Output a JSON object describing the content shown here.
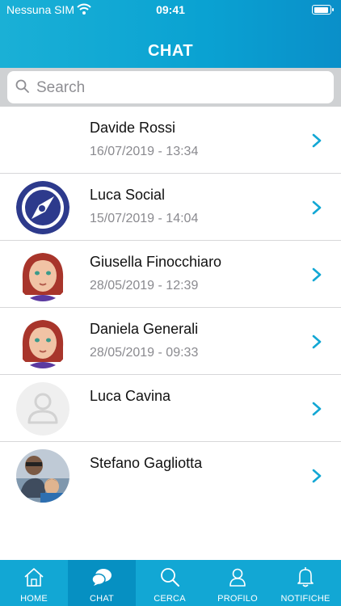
{
  "status_bar": {
    "carrier": "Nessuna SIM",
    "time": "09:41"
  },
  "header": {
    "title": "CHAT"
  },
  "search": {
    "placeholder": "Search"
  },
  "chats": [
    {
      "name": "Davide Rossi",
      "date": "16/07/2019 - 13:34",
      "avatar": "blank-avatar"
    },
    {
      "name": "Luca Social",
      "date": "15/07/2019 - 14:04",
      "avatar": "compass-logo"
    },
    {
      "name": "Giusella Finocchiaro",
      "date": "28/05/2019 - 12:39",
      "avatar": "cartoon-woman"
    },
    {
      "name": "Daniela Generali",
      "date": "28/05/2019 - 09:33",
      "avatar": "cartoon-woman"
    },
    {
      "name": "Luca Cavina",
      "date": "",
      "avatar": "placeholder-user"
    },
    {
      "name": "Stefano Gagliotta",
      "date": "",
      "avatar": "photo"
    }
  ],
  "tabs": [
    {
      "label": "HOME",
      "icon": "home-icon",
      "active": false
    },
    {
      "label": "CHAT",
      "icon": "chat-bubble-icon",
      "active": true
    },
    {
      "label": "CERCA",
      "icon": "search-icon",
      "active": false
    },
    {
      "label": "PROFILO",
      "icon": "user-icon",
      "active": false
    },
    {
      "label": "NOTIFICHE",
      "icon": "bell-icon",
      "active": false
    }
  ],
  "colors": {
    "header": "#0aa2d2",
    "tabbar": "#12a7d4",
    "tab_active": "#0690c2",
    "chevron": "#12a7d4"
  }
}
